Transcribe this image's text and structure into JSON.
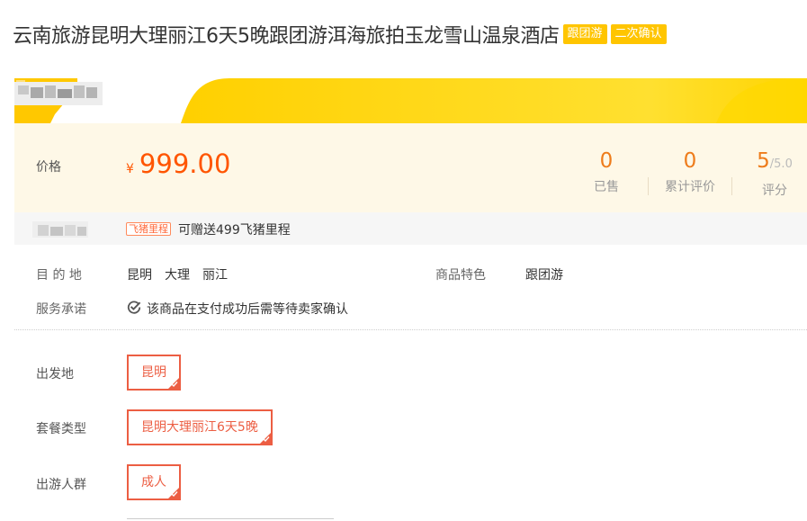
{
  "header": {
    "title": "云南旅游昆明大理丽江6天5晚跟团游洱海旅拍玉龙雪山温泉酒店",
    "tags": [
      "跟团游",
      "二次确认"
    ]
  },
  "colors": {
    "accent_orange": "#ff5500",
    "badge_yellow": "#ffc500",
    "option_border": "#ec5e43",
    "price_panel_bg": "#fef8e7"
  },
  "price": {
    "label": "价格",
    "currency": "¥",
    "value": "999.00"
  },
  "stats": [
    {
      "value": "0",
      "label": "已售"
    },
    {
      "value": "0",
      "label": "累计评价"
    },
    {
      "value": "5",
      "suffix": "/5.0",
      "label": "评分"
    }
  ],
  "mileage": {
    "tag": "飞猪里程",
    "text": "可赠送499飞猪里程"
  },
  "info": {
    "destination_label": "目 的 地",
    "destinations": [
      "昆明",
      "大理",
      "丽江"
    ],
    "feature_label": "商品特色",
    "feature_value": "跟团游",
    "service_label": "服务承诺",
    "service_value": "该商品在支付成功后需等待卖家确认",
    "service_icon": "check-circle-icon"
  },
  "options": {
    "departure": {
      "label": "出发地",
      "selected": "昆明"
    },
    "package": {
      "label": "套餐类型",
      "selected": "昆明大理丽江6天5晚"
    },
    "traveler": {
      "label": "出游人群",
      "selected": "成人"
    }
  }
}
